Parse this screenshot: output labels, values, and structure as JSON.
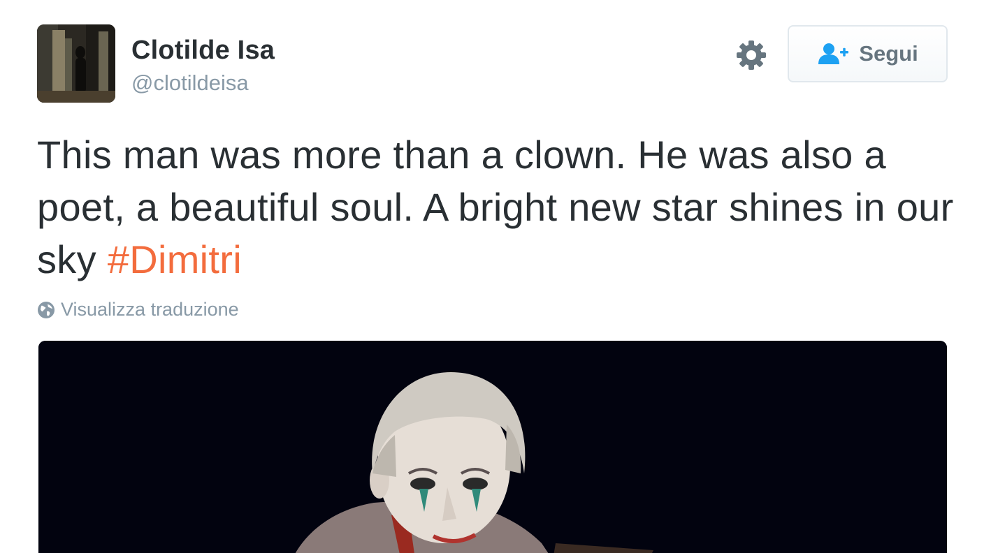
{
  "user": {
    "name": "Clotilde Isa",
    "handle": "@clotildeisa",
    "avatar_icon": "avatar-photo"
  },
  "actions": {
    "settings_icon": "gear-icon",
    "follow_icon": "user-plus-icon",
    "follow_label": "Segui"
  },
  "tweet": {
    "text_before": "This man was more than a clown. He was also a poet, a beautiful soul. A bright new star shines in our sky ",
    "hashtag": "#Dimitri",
    "translate_label": "Visualizza traduzione",
    "translate_icon": "globe-icon"
  },
  "colors": {
    "hashtag": "#f36c3d",
    "follow_icon": "#1da1f2",
    "secondary_text": "#8899a6",
    "primary_text": "#292f33"
  }
}
